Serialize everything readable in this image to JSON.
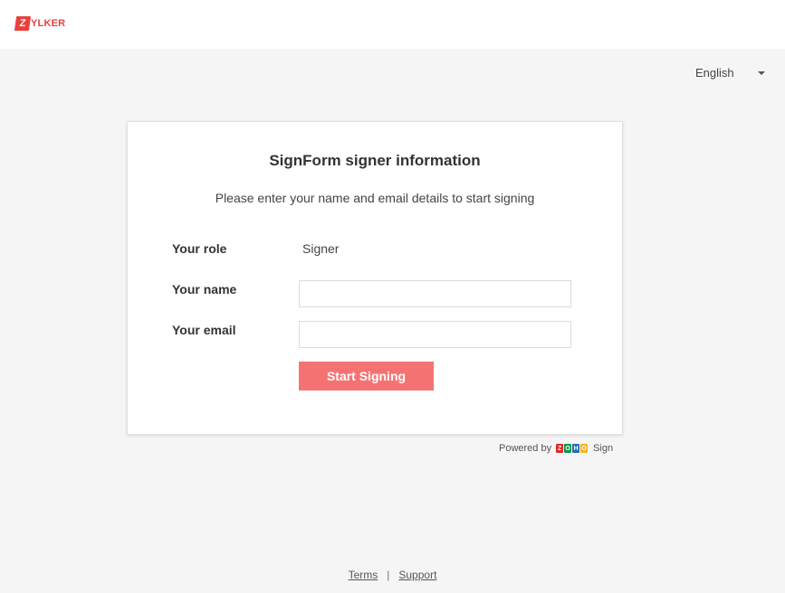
{
  "header": {
    "logo_letter": "Z",
    "logo_text": "YLKER",
    "brand_color": "#e8413c"
  },
  "language": {
    "selected": "English",
    "icon": "caret-down-icon"
  },
  "form": {
    "title": "SignForm signer information",
    "subtitle": "Please enter your name and email details to start signing",
    "role_label": "Your role",
    "role_value": "Signer",
    "name_label": "Your name",
    "name_value": "",
    "email_label": "Your email",
    "email_value": "",
    "submit_label": "Start Signing",
    "submit_color": "#f47372"
  },
  "powered": {
    "prefix": "Powered by",
    "zoho_letters": [
      "Z",
      "O",
      "H",
      "O"
    ],
    "zoho_colors": [
      "#e42527",
      "#089949",
      "#226db4",
      "#f9b21d"
    ],
    "product": "Sign"
  },
  "footer": {
    "terms": "Terms",
    "separator": "|",
    "support": "Support"
  }
}
